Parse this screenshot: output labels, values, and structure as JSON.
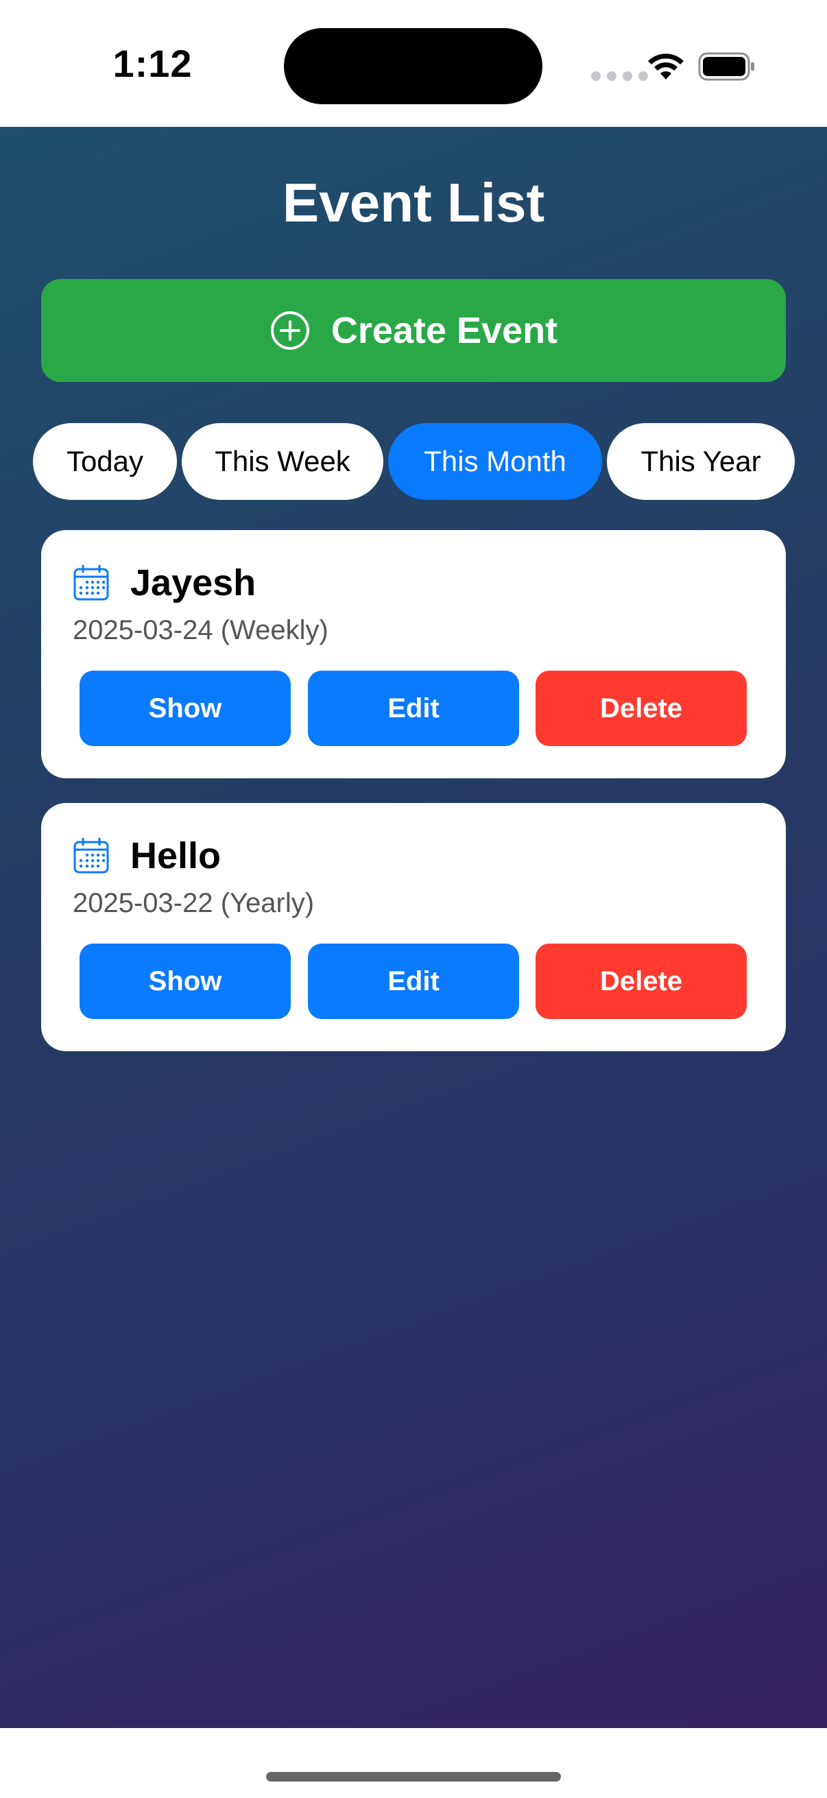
{
  "status_bar": {
    "time": "1:12"
  },
  "header": {
    "title": "Event List"
  },
  "create_button": {
    "label": "Create Event",
    "icon": "plus-circle-icon",
    "color": "#2aa847"
  },
  "filters": {
    "selected": "This Month",
    "items": [
      {
        "label": "Today"
      },
      {
        "label": "This Week"
      },
      {
        "label": "This Month"
      },
      {
        "label": "This Year"
      }
    ]
  },
  "events": [
    {
      "name": "Jayesh",
      "date": "2025-03-24 (Weekly)",
      "icon": "calendar-icon",
      "actions": {
        "show": "Show",
        "edit": "Edit",
        "delete": "Delete"
      }
    },
    {
      "name": "Hello",
      "date": "2025-03-22 (Yearly)",
      "icon": "calendar-icon",
      "actions": {
        "show": "Show",
        "edit": "Edit",
        "delete": "Delete"
      }
    }
  ],
  "colors": {
    "accent_blue": "#0a7aff",
    "danger_red": "#ff3b30",
    "success_green": "#2aa847"
  }
}
